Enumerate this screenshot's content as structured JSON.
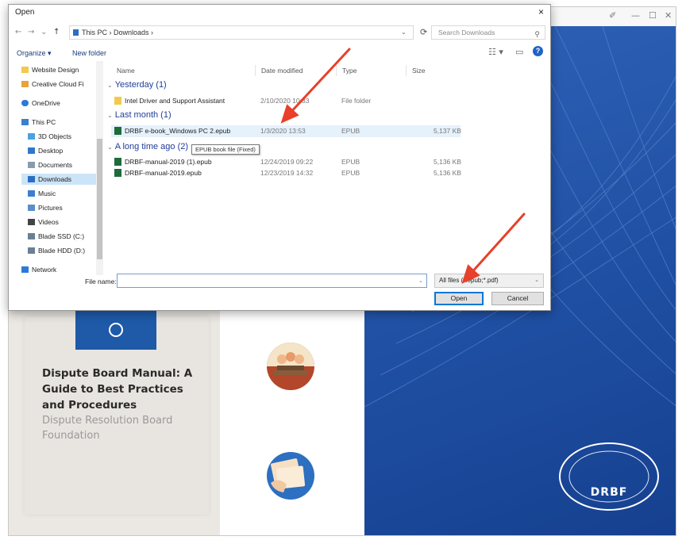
{
  "dialog": {
    "title": "Open",
    "close_label": "×",
    "nav": {
      "back": "←",
      "forward": "→",
      "recent": "⌄",
      "up": "↑"
    },
    "address_path": "This PC  ›  Downloads  ›",
    "search_placeholder": "Search Downloads",
    "toolbar": {
      "organize": "Organize ▾",
      "new_folder": "New folder",
      "help": "?"
    },
    "nav_pane": [
      {
        "label": "Website Design",
        "icon": "folder-icon",
        "color": "#f2c94c"
      },
      {
        "label": "Creative Cloud Fi",
        "icon": "creative-cloud-icon",
        "color": "#e8a33c"
      },
      {
        "label": "OneDrive",
        "icon": "cloud-icon",
        "color": "#2a7ad6"
      },
      {
        "label": "This PC",
        "icon": "computer-icon",
        "color": "#3b7fd1"
      },
      {
        "label": "3D Objects",
        "icon": "cube-icon",
        "color": "#4aa3e0"
      },
      {
        "label": "Desktop",
        "icon": "desktop-icon",
        "color": "#2f78c9"
      },
      {
        "label": "Documents",
        "icon": "document-icon",
        "color": "#8a9bb0"
      },
      {
        "label": "Downloads",
        "icon": "download-icon",
        "color": "#2b6fc4"
      },
      {
        "label": "Music",
        "icon": "music-icon",
        "color": "#3b7fd1"
      },
      {
        "label": "Pictures",
        "icon": "picture-icon",
        "color": "#5a8fc8"
      },
      {
        "label": "Videos",
        "icon": "video-icon",
        "color": "#444444"
      },
      {
        "label": "Blade SSD (C:)",
        "icon": "drive-icon",
        "color": "#6a7f95"
      },
      {
        "label": "Blade HDD (D:)",
        "icon": "drive-icon",
        "color": "#6a7f95"
      },
      {
        "label": "Network",
        "icon": "network-icon",
        "color": "#2a7ad6"
      }
    ],
    "columns": {
      "name": "Name",
      "date": "Date modified",
      "type": "Type",
      "size": "Size"
    },
    "groups": [
      {
        "label": "Yesterday (1)",
        "files": [
          {
            "name": "Intel Driver and Support Assistant",
            "date": "2/10/2020 10:33",
            "type": "File folder",
            "size": "",
            "icon": "folder-icon"
          }
        ]
      },
      {
        "label": "Last month (1)",
        "files": [
          {
            "name": "DRBF e-book_Windows PC 2.epub",
            "date": "1/3/2020 13:53",
            "type": "EPUB",
            "size": "5,137 KB",
            "icon": "epub-icon"
          }
        ]
      },
      {
        "label": "A long time ago (2)",
        "files": [
          {
            "name": "DRBF-manual-2019 (1).epub",
            "date": "12/24/2019 09:22",
            "type": "EPUB",
            "size": "5,136 KB",
            "icon": "epub-icon"
          },
          {
            "name": "DRBF-manual-2019.epub",
            "date": "12/23/2019 14:32",
            "type": "EPUB",
            "size": "5,136 KB",
            "icon": "epub-icon"
          }
        ]
      }
    ],
    "tooltip": "EPUB book file (Fixed)",
    "file_name_label": "File name:",
    "file_name_value": "",
    "file_type_filter": "All files (*.epub;*.pdf)",
    "open_label": "Open",
    "cancel_label": "Cancel"
  },
  "background_app": {
    "window_controls": {
      "edit": "✐",
      "minimize": "—",
      "maximize": "☐",
      "close": "✕"
    },
    "book_title": "Dispute Board Manual: A Guide to Best Practices and Procedures",
    "book_publisher": "Dispute Resolution Board Foundation",
    "logo_text": "DRBF",
    "colors": {
      "accent": "#1e5aa8",
      "annotation_arrow": "#e8402a"
    }
  }
}
